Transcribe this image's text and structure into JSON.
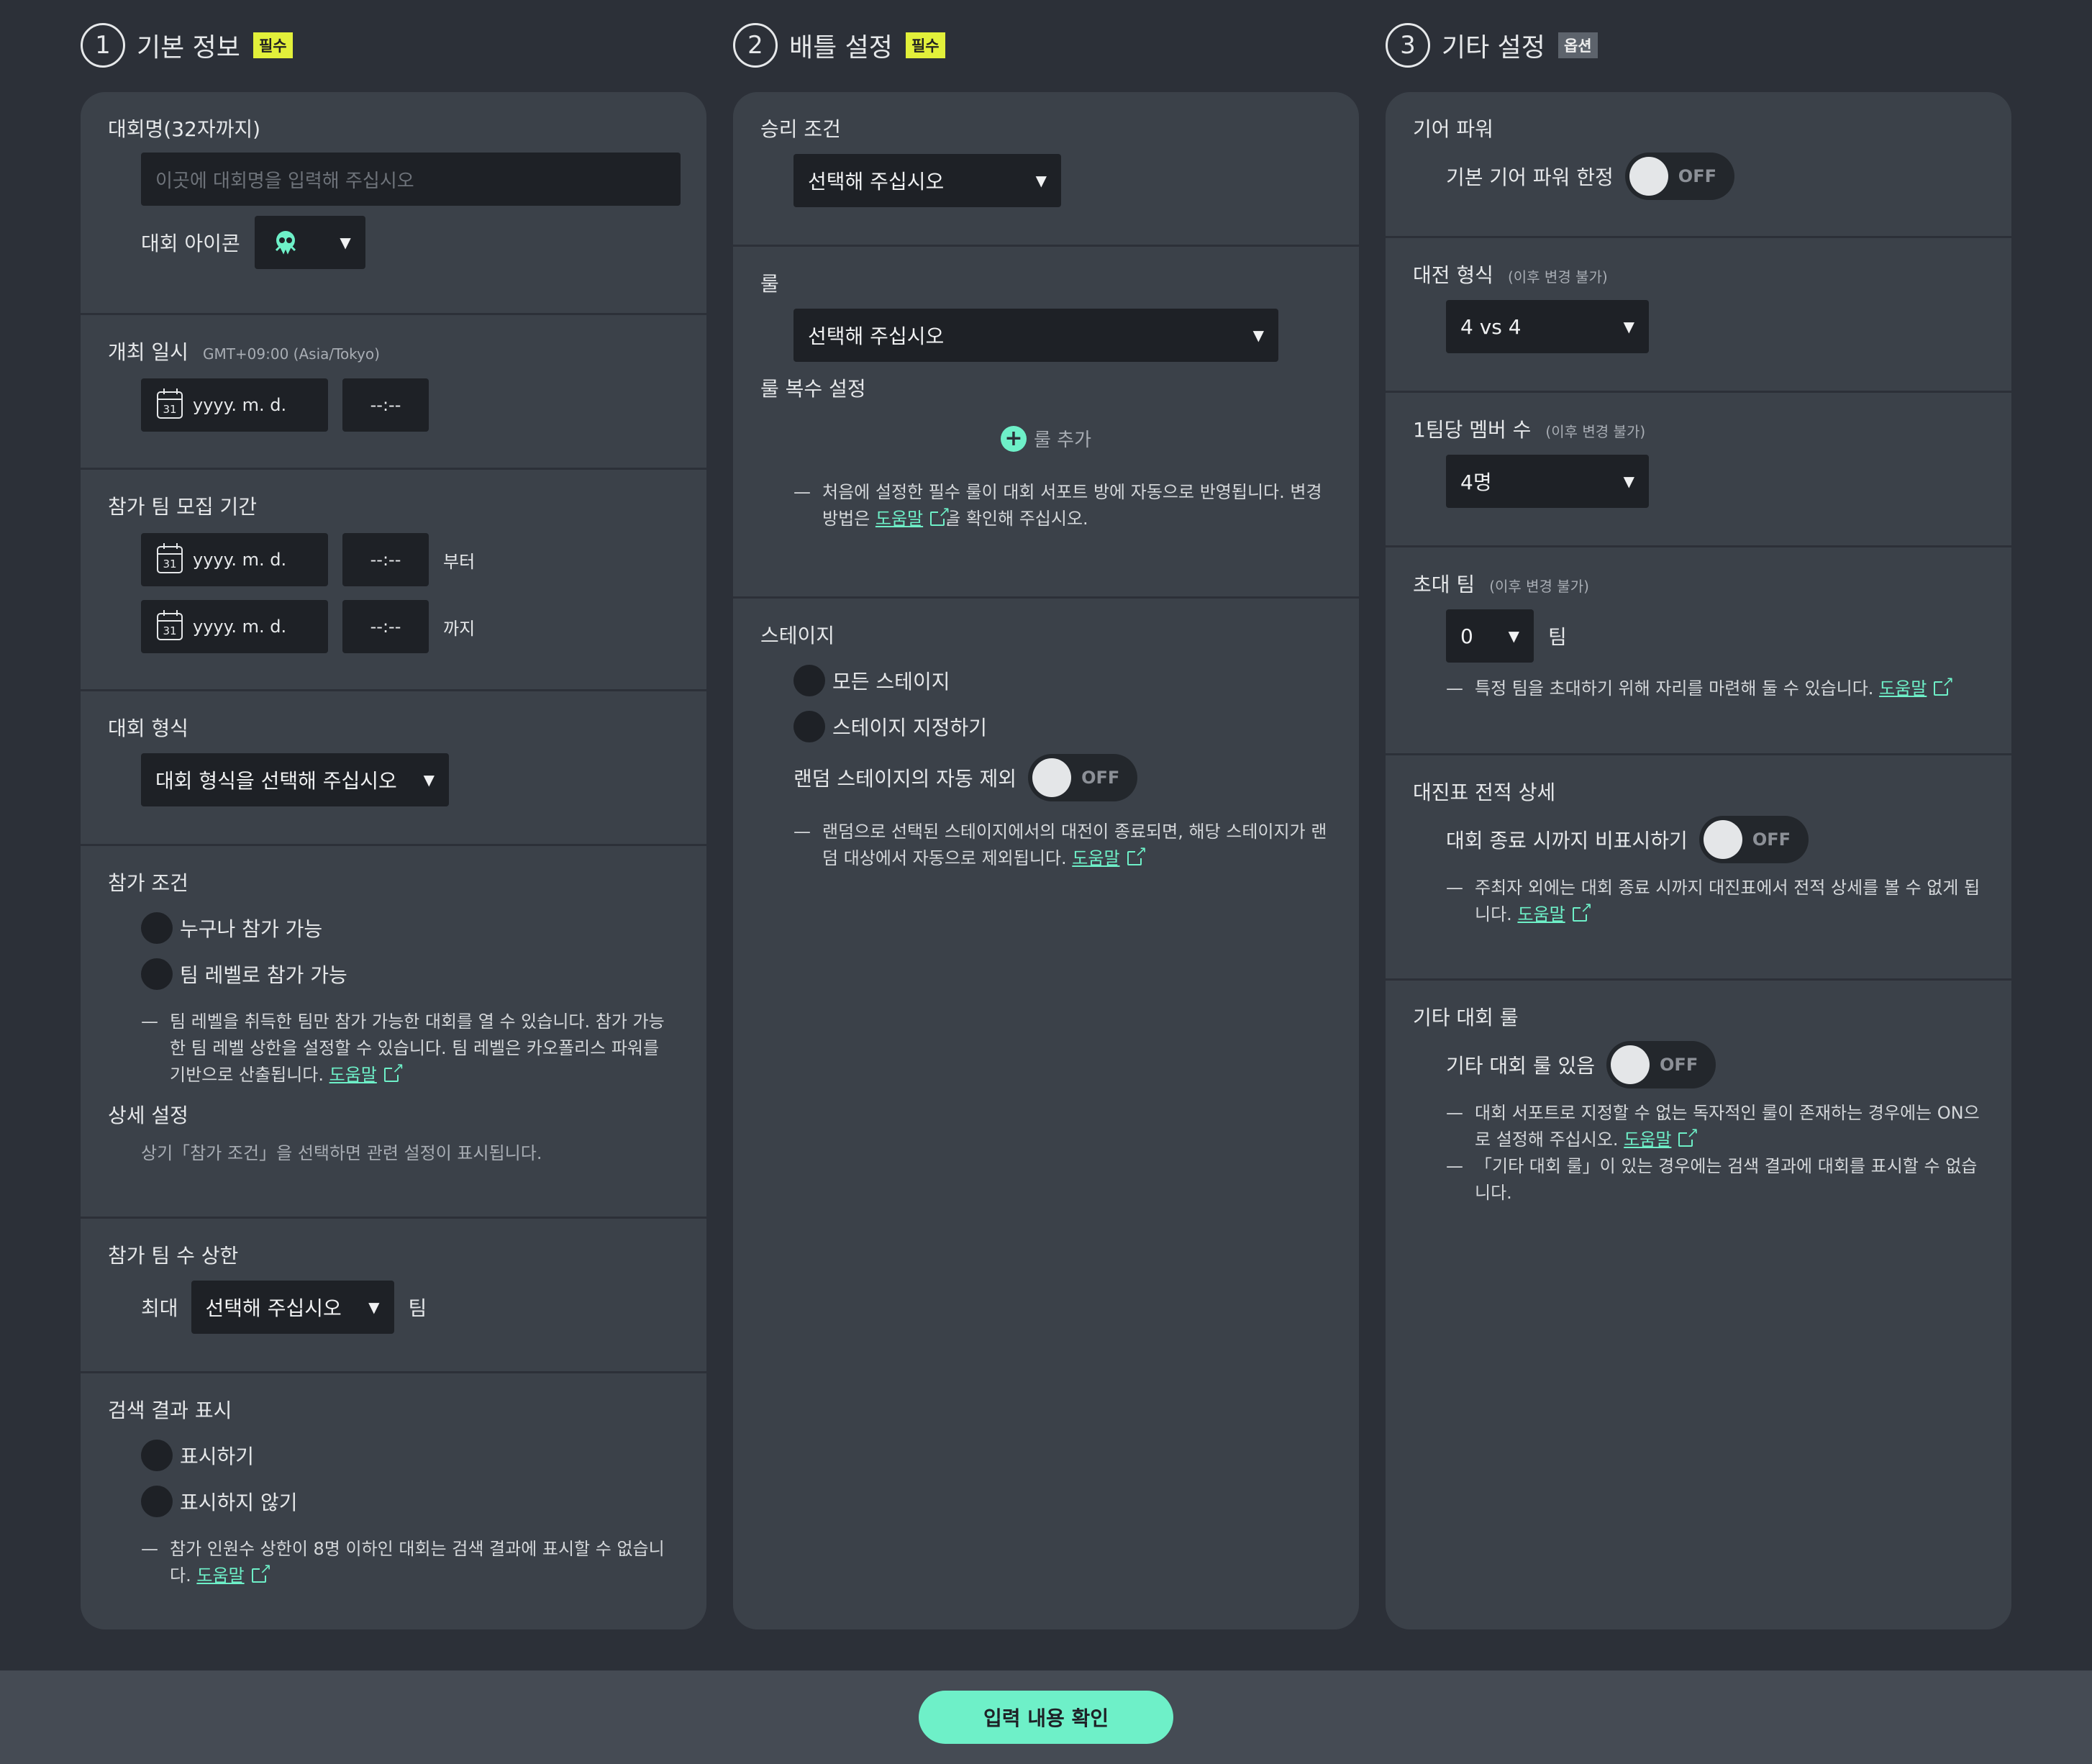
{
  "sections": {
    "basic": {
      "num": "1",
      "title": "기본 정보",
      "badge": "필수"
    },
    "battle": {
      "num": "2",
      "title": "배틀 설정",
      "badge": "필수"
    },
    "other": {
      "num": "3",
      "title": "기타 설정",
      "badge": "옵션"
    }
  },
  "basic": {
    "name_label": "대회명(32자까지)",
    "name_placeholder": "이곳에 대회명을 입력해 주십시오",
    "icon_label": "대회 아이콘",
    "icon_name": "squid-face-icon",
    "datetime_label": "개최 일시",
    "timezone": "GMT+09:00 (Asia/Tokyo)",
    "date_placeholder": "yyyy. m. d.",
    "time_placeholder": "--:--",
    "calendar_day": "31",
    "recruit_label": "참가 팀 모집 기간",
    "from_label": "부터",
    "to_label": "까지",
    "format_label": "대회 형식",
    "format_select": "대회 형식을 선택해 주십시오",
    "entry_label": "참가 조건",
    "entry_options": [
      "누구나 참가 가능",
      "팀 레벨로 참가 가능"
    ],
    "entry_note": "팀 레벨을 취득한 팀만 참가 가능한 대회를 열 수 있습니다. 참가 가능한 팀 레벨 상한을 설정할 수 있습니다. 팀 레벨은 카오폴리스 파워를 기반으로 산출됩니다.",
    "detail_label": "상세 설정",
    "detail_note": "상기「참가 조건」을 선택하면 관련 설정이 표시됩니다.",
    "team_max_label": "참가 팀 수 상한",
    "max_prefix": "최대",
    "max_select": "선택해 주십시오",
    "team_suffix": "팀",
    "search_label": "검색 결과 표시",
    "search_options": [
      "표시하기",
      "표시하지 않기"
    ],
    "search_note": "참가 인원수 상한이 8명 이하인 대회는 검색 결과에 표시할 수 없습니다."
  },
  "battle": {
    "win_label": "승리 조건",
    "win_select": "선택해 주십시오",
    "rule_label": "룰",
    "rule_select": "선택해 주십시오",
    "multi_rule_label": "룰 복수 설정",
    "add_rule": "룰 추가",
    "rule_note_1": "처음에 설정한 필수 룰이 대회 서포트 방에 자동으로 반영됩니다. 변경 방법은 ",
    "rule_note_2": "을 확인해 주십시오.",
    "stage_label": "스테이지",
    "stage_options": [
      "모든 스테이지",
      "스테이지 지정하기"
    ],
    "random_label": "랜덤 스테이지의 자동 제외",
    "stage_note": "랜덤으로 선택된 스테이지에서의 대전이 종료되면, 해당 스테이지가 랜덤 대상에서 자동으로 제외됩니다."
  },
  "other": {
    "gear_label": "기어 파워",
    "gear_toggle_label": "기본 기어 파워 한정",
    "match_format_label": "대전 형식",
    "locked_hint": "(이후 변경 불가)",
    "match_format_select": "4 vs 4",
    "members_label": "1팀당 멤버 수",
    "members_select": "4명",
    "invite_label": "초대 팀",
    "invite_select": "0",
    "invite_suffix": "팀",
    "invite_note": "특정 팀을 초대하기 위해 자리를 마련해 둘 수 있습니다.",
    "bracket_label": "대진표 전적 상세",
    "bracket_toggle_label": "대회 종료 시까지 비표시하기",
    "bracket_note": "주최자 외에는 대회 종료 시까지 대진표에서 전적 상세를 볼 수 없게 됩니다.",
    "other_rule_label": "기타 대회 룰",
    "other_rule_toggle_label": "기타 대회 룰 있음",
    "other_rule_note_1": "대회 서포트로 지정할 수 없는 독자적인 룰이 존재하는 경우에는 ON으로 설정해 주십시오.",
    "other_rule_note_2": "「기타 대회 룰」이 있는 경우에는 검색 결과에 대회를 표시할 수 없습니다."
  },
  "common": {
    "help_link": "도움말",
    "toggle_off": "OFF",
    "dash": "—"
  },
  "footer": {
    "confirm_label": "입력 내용 확인"
  },
  "colors": {
    "accent": "#6ef0c8",
    "required_badge": "#e2f03a",
    "background": "#2c3038",
    "card": "#3b4149"
  }
}
